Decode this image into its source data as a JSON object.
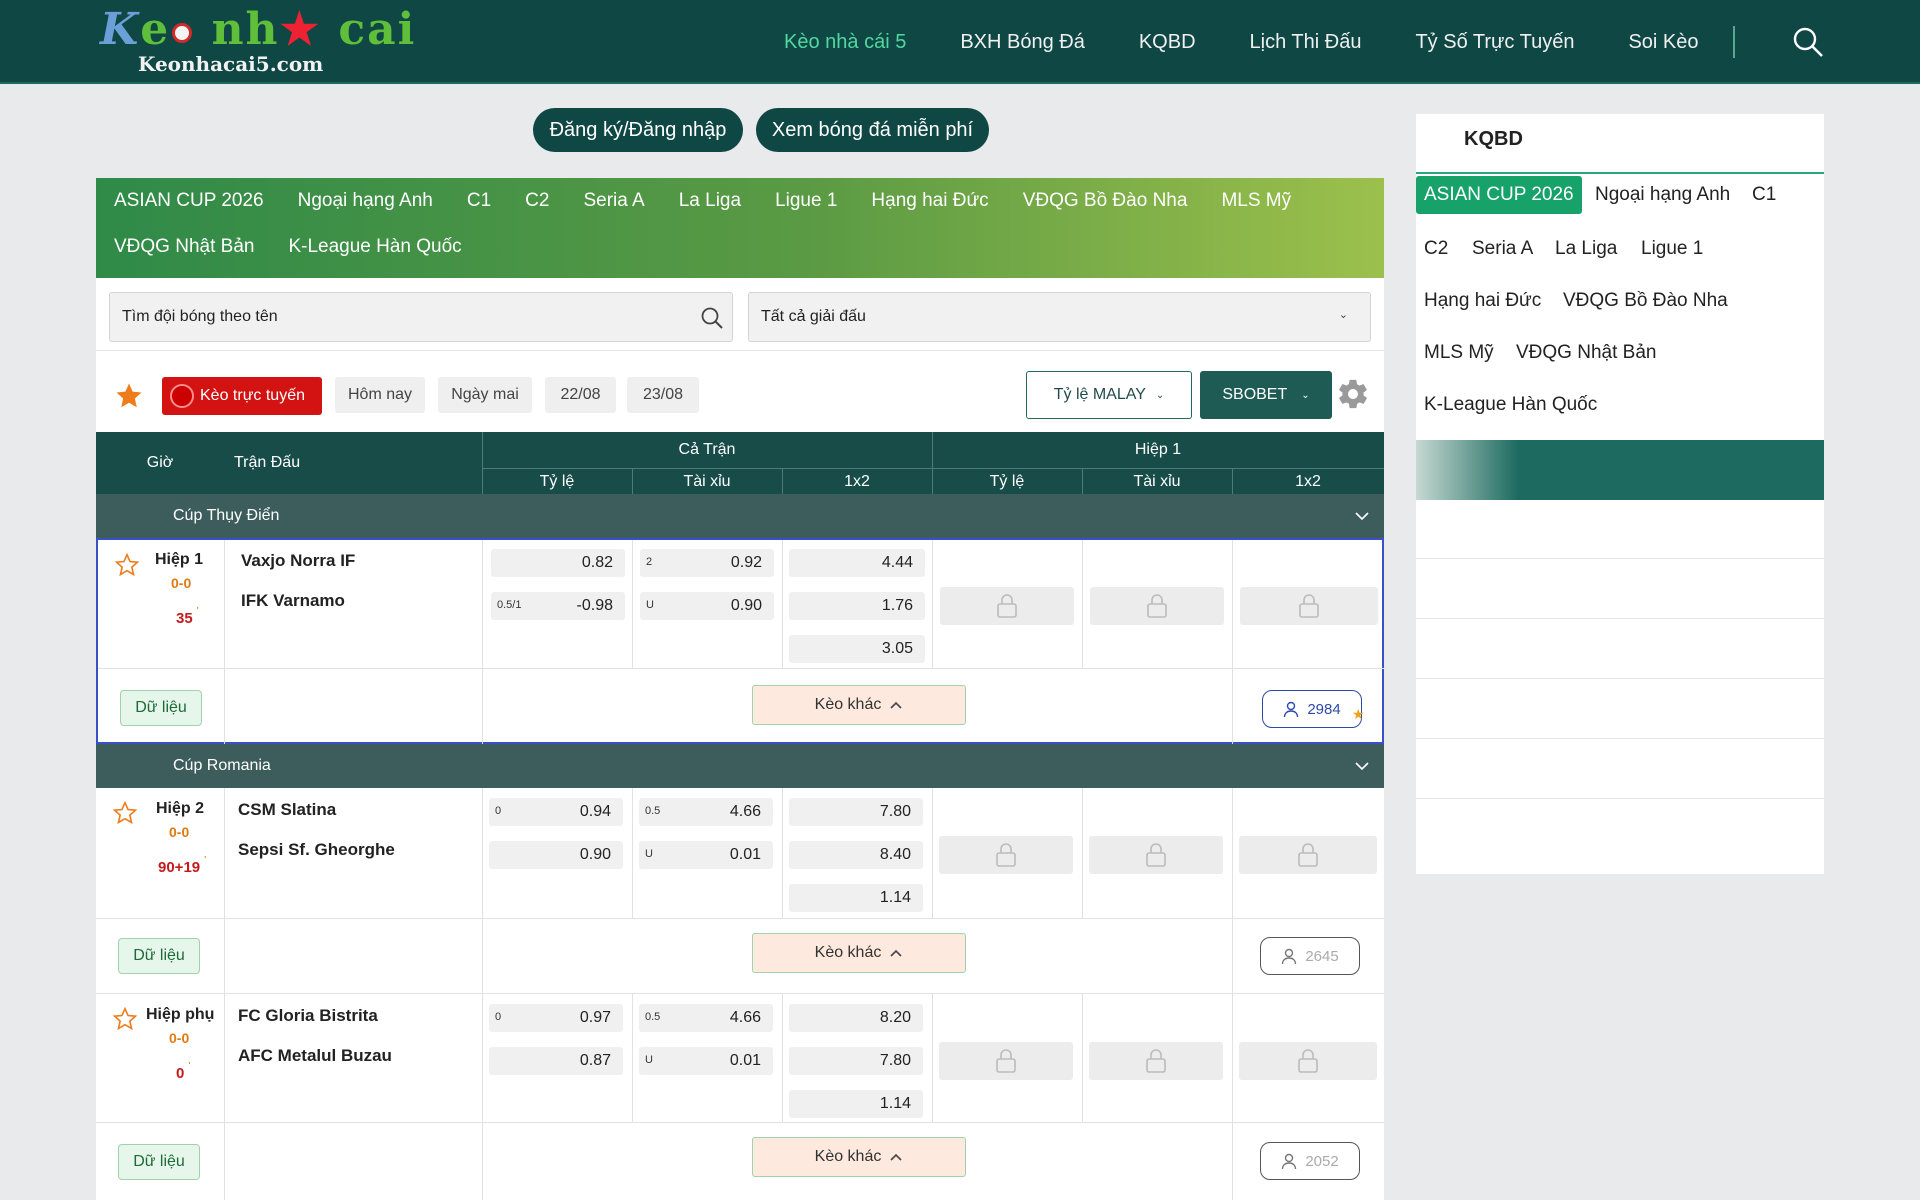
{
  "header": {
    "logo_main": "Keo nha cai",
    "logo_sub": "Keonhacai5.com",
    "nav": [
      "Kèo nhà cái 5",
      "BXH Bóng Đá",
      "KQBD",
      "Lịch Thi Đấu",
      "Tỷ Số Trực Tuyến",
      "Soi Kèo"
    ],
    "active_nav": "Kèo nhà cái 5",
    "search_icon": "search-icon"
  },
  "top_buttons": {
    "login": "Đăng ký/Đăng nhập",
    "watch": "Xem bóng đá miễn phí"
  },
  "league_tabs": {
    "row1": [
      "ASIAN CUP 2026",
      "Ngoại hạng Anh",
      "C1",
      "C2",
      "Seria A",
      "La Liga",
      "Ligue 1",
      "Hạng hai Đức",
      "VĐQG Bồ Đào Nha",
      "MLS Mỹ"
    ],
    "row2": [
      "VĐQG Nhật Bản",
      "K-League Hàn Quốc"
    ]
  },
  "filters": {
    "search_placeholder": "Tìm đội bóng theo tên",
    "league_select": "Tất cả giải đấu"
  },
  "toolbar": {
    "live": "Kèo trực tuyến",
    "days": [
      "Hôm nay",
      "Ngày mai",
      "22/08",
      "23/08"
    ],
    "odds_type": "Tỷ lệ MALAY",
    "bookmaker": "SBOBET"
  },
  "table_header": {
    "time": "Giờ",
    "match": "Trận Đấu",
    "full_match": "Cả Trận",
    "half1": "Hiệp 1",
    "sub": [
      "Tỷ lệ",
      "Tài xỉu",
      "1x2",
      "Tỷ lệ",
      "Tài xỉu",
      "1x2"
    ]
  },
  "competitions": [
    {
      "name": "Cúp Thụy Điển",
      "match": {
        "status": "Hiệp 1",
        "score": "0-0",
        "minute": "35",
        "home": "Vaxjo Norra IF",
        "away": "IFK Varnamo",
        "handicap": [
          {
            "label": "",
            "value": "0.82"
          },
          {
            "label": "0.5/1",
            "value": "-0.98"
          }
        ],
        "overunder": [
          {
            "label": "2",
            "value": "0.92"
          },
          {
            "label": "U",
            "value": "0.90"
          }
        ],
        "x12": [
          "4.44",
          "1.76",
          "3.05"
        ],
        "data_label": "Dữ liệu",
        "more_label": "Kèo khác",
        "followers": "2984"
      }
    },
    {
      "name": "Cúp Romania",
      "matches": [
        {
          "status": "Hiệp 2",
          "score": "0-0",
          "minute": "90+19",
          "home": "CSM Slatina",
          "away": "Sepsi Sf. Gheorghe",
          "handicap": [
            {
              "label": "0",
              "value": "0.94"
            },
            {
              "label": "",
              "value": "0.90"
            }
          ],
          "overunder": [
            {
              "label": "0.5",
              "value": "4.66"
            },
            {
              "label": "U",
              "value": "0.01"
            }
          ],
          "x12": [
            "7.80",
            "8.40",
            "1.14"
          ],
          "data_label": "Dữ liệu",
          "more_label": "Kèo khác",
          "followers": "2645"
        },
        {
          "status": "Hiệp phụ",
          "score": "0-0",
          "minute": "0",
          "home": "FC Gloria Bistrita",
          "away": "AFC Metalul Buzau",
          "handicap": [
            {
              "label": "0",
              "value": "0.97"
            },
            {
              "label": "",
              "value": "0.87"
            }
          ],
          "overunder": [
            {
              "label": "0.5",
              "value": "4.66"
            },
            {
              "label": "U",
              "value": "0.01"
            }
          ],
          "x12": [
            "8.20",
            "7.80",
            "1.14"
          ],
          "data_label": "Dữ liệu",
          "more_label": "Kèo khác",
          "followers": "2052"
        }
      ]
    }
  ],
  "sidebar": {
    "title": "KQBD",
    "tags": [
      "ASIAN CUP 2026",
      "Ngoại hạng Anh",
      "C1",
      "C2",
      "Seria A",
      "La Liga",
      "Ligue 1",
      "Hạng hai Đức",
      "VĐQG Bồ Đào Nha",
      "MLS Mỹ",
      "VĐQG Nhật Bản",
      "K-League Hàn Quốc"
    ],
    "active_tag": "ASIAN CUP 2026"
  },
  "colors": {
    "header_bg": "#0f4744",
    "accent": "#17a26a",
    "live": "#d31212",
    "table_header": "#174c48"
  }
}
